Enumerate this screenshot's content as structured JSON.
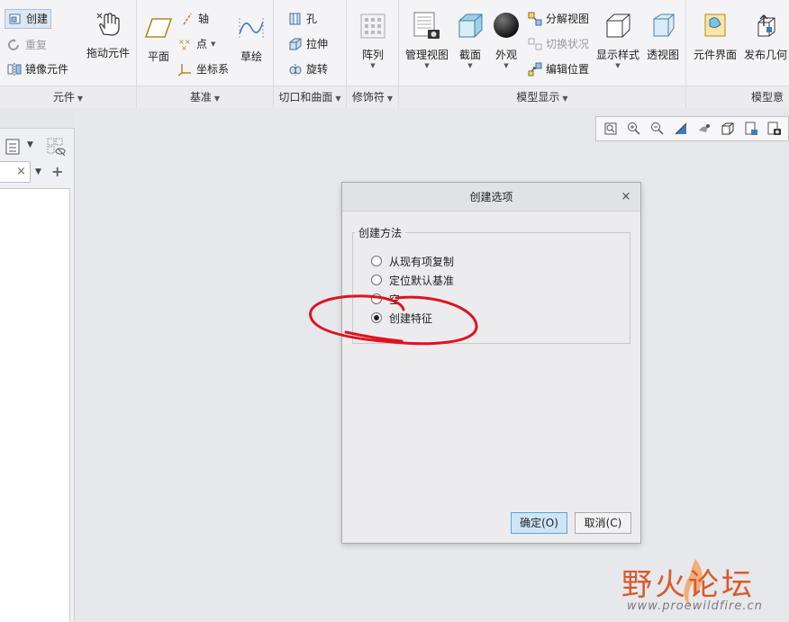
{
  "ribbon": {
    "groups": {
      "component": {
        "label": "元件"
      },
      "datum": {
        "label": "基准"
      },
      "cut_surface": {
        "label": "切口和曲面"
      },
      "modifier": {
        "label": "修饰符"
      },
      "model_display": {
        "label": "模型显示"
      },
      "model_intent": {
        "label": "模型意"
      }
    },
    "component": {
      "create": "创建",
      "redo": "重复",
      "mirror": "镜像元件",
      "drag": "拖动元件"
    },
    "datum": {
      "plane": "平面",
      "axis": "轴",
      "point": "点",
      "csys": "坐标系",
      "sketch": "草绘"
    },
    "cut_surface": {
      "hole": "孔",
      "extrude": "拉伸",
      "revolve": "旋转"
    },
    "modifier": {
      "pattern": "阵列"
    },
    "model_display": {
      "manage_views": "管理视图",
      "section": "截面",
      "appearance": "外观",
      "exploded_view": "分解视图",
      "toggle_status": "切换状况",
      "edit_position": "编辑位置",
      "display_style": "显示样式",
      "perspective": "透视图"
    },
    "model_intent": {
      "component_interface": "元件界面",
      "publish_geometry": "发布几何"
    }
  },
  "dialog": {
    "title": "创建选项",
    "close_icon": "×",
    "method_group_label": "创建方法",
    "options": [
      {
        "label": "从现有项复制",
        "selected": false
      },
      {
        "label": "定位默认基准",
        "selected": false
      },
      {
        "label": "空",
        "selected": false
      },
      {
        "label": "创建特征",
        "selected": true
      }
    ],
    "ok_label": "确定(O)",
    "cancel_label": "取消(C)"
  },
  "left_panel": {
    "search_clear": "×",
    "add": "+"
  },
  "watermark": {
    "text": "野火论坛",
    "url": "www.proewildfire.cn"
  },
  "colors": {
    "annotation_scribble": "#e0121e",
    "ok_button_bg": "#cde6f7",
    "watermark": "#d95a2b"
  }
}
